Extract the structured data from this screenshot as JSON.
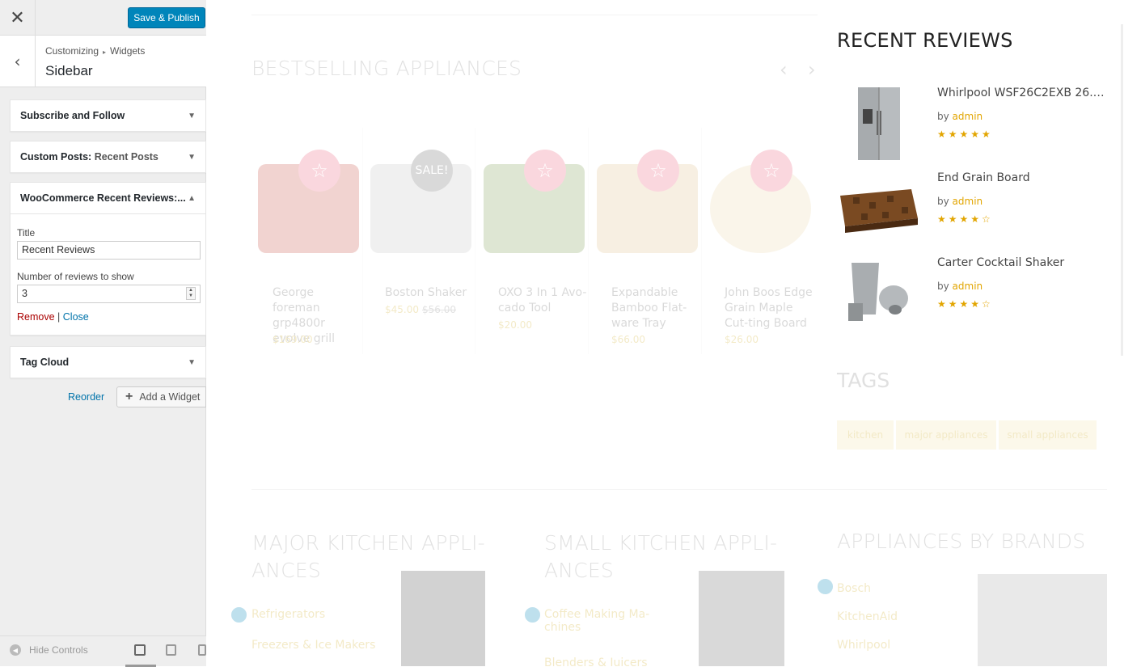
{
  "customizer": {
    "close_label": "✕",
    "publish_label": "Save & Publish",
    "back_label": "‹",
    "breadcrumb_root": "Customizing",
    "breadcrumb_sep": "▸",
    "breadcrumb_section": "Widgets",
    "section_title": "Sidebar",
    "widgets": [
      {
        "title": "Subscribe and Follow",
        "subtitle": "",
        "arrow": "▼"
      },
      {
        "title": "Custom Posts:",
        "subtitle": "Recent Posts",
        "arrow": "▼"
      },
      {
        "title": "WooCommerce Recent Reviews:...",
        "subtitle": "",
        "arrow": "▲"
      },
      {
        "title": "Tag Cloud",
        "subtitle": "",
        "arrow": "▼"
      }
    ],
    "open_widget": {
      "title_label": "Title",
      "title_value": "Recent Reviews",
      "count_label": "Number of reviews to show",
      "count_value": "3",
      "remove_label": "Remove",
      "separator": "|",
      "close_label": "Close"
    },
    "reorder_label": "Reorder",
    "add_widget_label": "Add a Widget",
    "add_widget_icon": "+",
    "hide_controls_label": "Hide Controls"
  },
  "preview": {
    "bestselling_title": "BESTSELLING APPLIANCES",
    "carousel_prev": "‹",
    "carousel_next": "›",
    "products": [
      {
        "name": "George foreman grp4800r evolve grill",
        "price": "$169.00",
        "old_price": "",
        "badge": "☆",
        "img_color": "#c0392b"
      },
      {
        "name": "Boston Shaker",
        "price": "$45.00",
        "old_price": "$56.00",
        "badge": "SALE!",
        "img_color": "#bbbbbb"
      },
      {
        "name": "OXO 3 In 1 Avo-cado Tool",
        "price": "$20.00",
        "old_price": "",
        "badge": "☆",
        "img_color": "#6a8f3a"
      },
      {
        "name": "Expandable Bamboo Flat-ware Tray",
        "price": "$66.00",
        "old_price": "",
        "badge": "☆",
        "img_color": "#d9b77a"
      },
      {
        "name": "John Boos Edge Grain Maple Cut-ting Board",
        "price": "$26.00",
        "old_price": "",
        "badge": "☆",
        "img_color": "#e6cf9f"
      }
    ],
    "reviews": {
      "title": "RECENT REVIEWS",
      "by_label": "by",
      "items": [
        {
          "name": "Whirlpool WSF26C2EXB 26.4 C...",
          "author": "admin",
          "stars": "★★★★★",
          "thumb": "fridge"
        },
        {
          "name": "End Grain Board",
          "author": "admin",
          "stars": "★★★★☆",
          "thumb": "board"
        },
        {
          "name": "Carter Cocktail Shaker",
          "author": "admin",
          "stars": "★★★★☆",
          "thumb": "shaker"
        }
      ]
    },
    "tags_title": "TAGS",
    "tags": [
      "kitchen",
      "major appliances",
      "small appliances"
    ],
    "bottom_sections": [
      {
        "title": "MAJOR KITCHEN APPLI-ANCES",
        "link1": "Refrigerators",
        "link2": "Freezers & Ice Makers"
      },
      {
        "title": "SMALL KITCHEN APPLI-ANCES",
        "link1": "Coffee Making Ma-chines",
        "link2": "Blenders & Juicers"
      },
      {
        "title": "APPLIANCES BY BRANDS",
        "link1": "Bosch",
        "link2": "KitchenAid",
        "link3": "Whirlpool"
      }
    ]
  }
}
